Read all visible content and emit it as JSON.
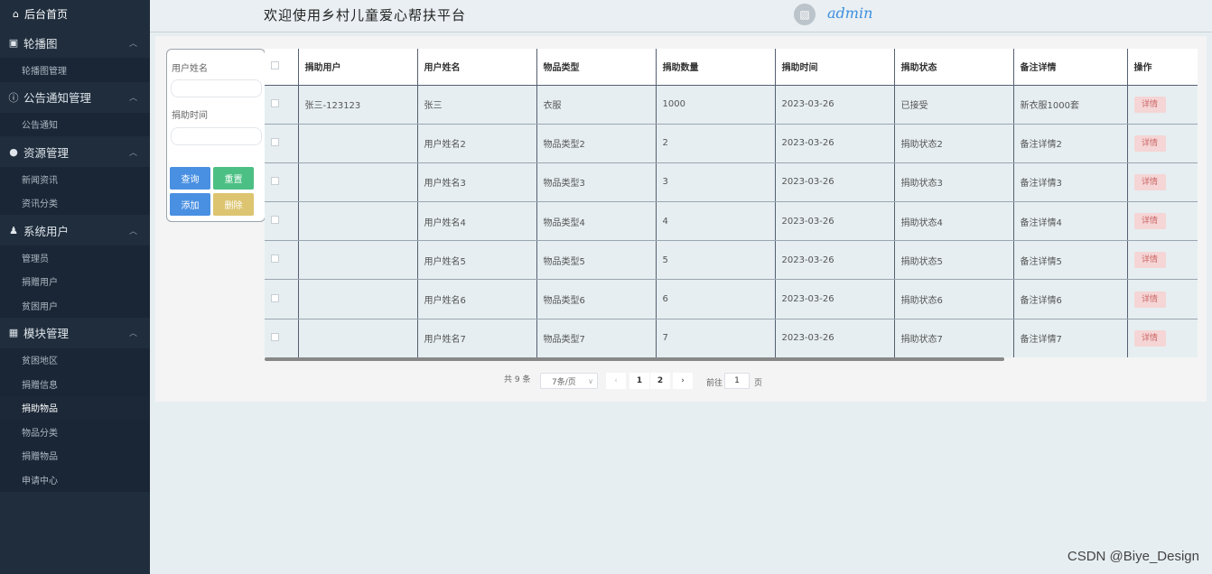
{
  "sidebar": {
    "home": "后台首页",
    "groups": [
      {
        "label": "轮播图",
        "items": [
          "轮播图管理"
        ]
      },
      {
        "label": "公告通知管理",
        "items": [
          "公告通知"
        ]
      },
      {
        "label": "资源管理",
        "items": [
          "新闻资讯",
          "资讯分类"
        ]
      },
      {
        "label": "系统用户",
        "items": [
          "管理员",
          "捐赠用户",
          "贫困用户"
        ]
      },
      {
        "label": "模块管理",
        "items": [
          "贫困地区",
          "捐赠信息",
          "捐助物品",
          "物品分类",
          "捐赠物品",
          "申请中心"
        ]
      }
    ],
    "active_item": "捐助物品"
  },
  "header": {
    "title": "欢迎使用乡村儿童爱心帮扶平台",
    "username": "admin"
  },
  "search": {
    "field1_label": "用户姓名",
    "field2_label": "捐助时间",
    "query_label": "查询",
    "reset_label": "重置",
    "add_label": "添加",
    "delete_label": "删除"
  },
  "table": {
    "columns": [
      "捐助用户",
      "用户姓名",
      "物品类型",
      "捐助数量",
      "捐助时间",
      "捐助状态",
      "备注详情",
      "操作"
    ],
    "rows": [
      [
        "张三-123123",
        "张三",
        "衣服",
        "1000",
        "2023-03-26",
        "已接受",
        "新衣服1000套"
      ],
      [
        "",
        "用户姓名2",
        "物品类型2",
        "2",
        "2023-03-26",
        "捐助状态2",
        "备注详情2"
      ],
      [
        "",
        "用户姓名3",
        "物品类型3",
        "3",
        "2023-03-26",
        "捐助状态3",
        "备注详情3"
      ],
      [
        "",
        "用户姓名4",
        "物品类型4",
        "4",
        "2023-03-26",
        "捐助状态4",
        "备注详情4"
      ],
      [
        "",
        "用户姓名5",
        "物品类型5",
        "5",
        "2023-03-26",
        "捐助状态5",
        "备注详情5"
      ],
      [
        "",
        "用户姓名6",
        "物品类型6",
        "6",
        "2023-03-26",
        "捐助状态6",
        "备注详情6"
      ],
      [
        "",
        "用户姓名7",
        "物品类型7",
        "7",
        "2023-03-26",
        "捐助状态7",
        "备注详情7"
      ]
    ],
    "action_label": "详情"
  },
  "pager": {
    "total": "共 9 条",
    "page_size": "7条/页",
    "pages": [
      "1",
      "2"
    ],
    "jump_prefix": "前往",
    "jump_value": "1",
    "jump_suffix": "页"
  },
  "watermark": "CSDN @Biye_Design"
}
